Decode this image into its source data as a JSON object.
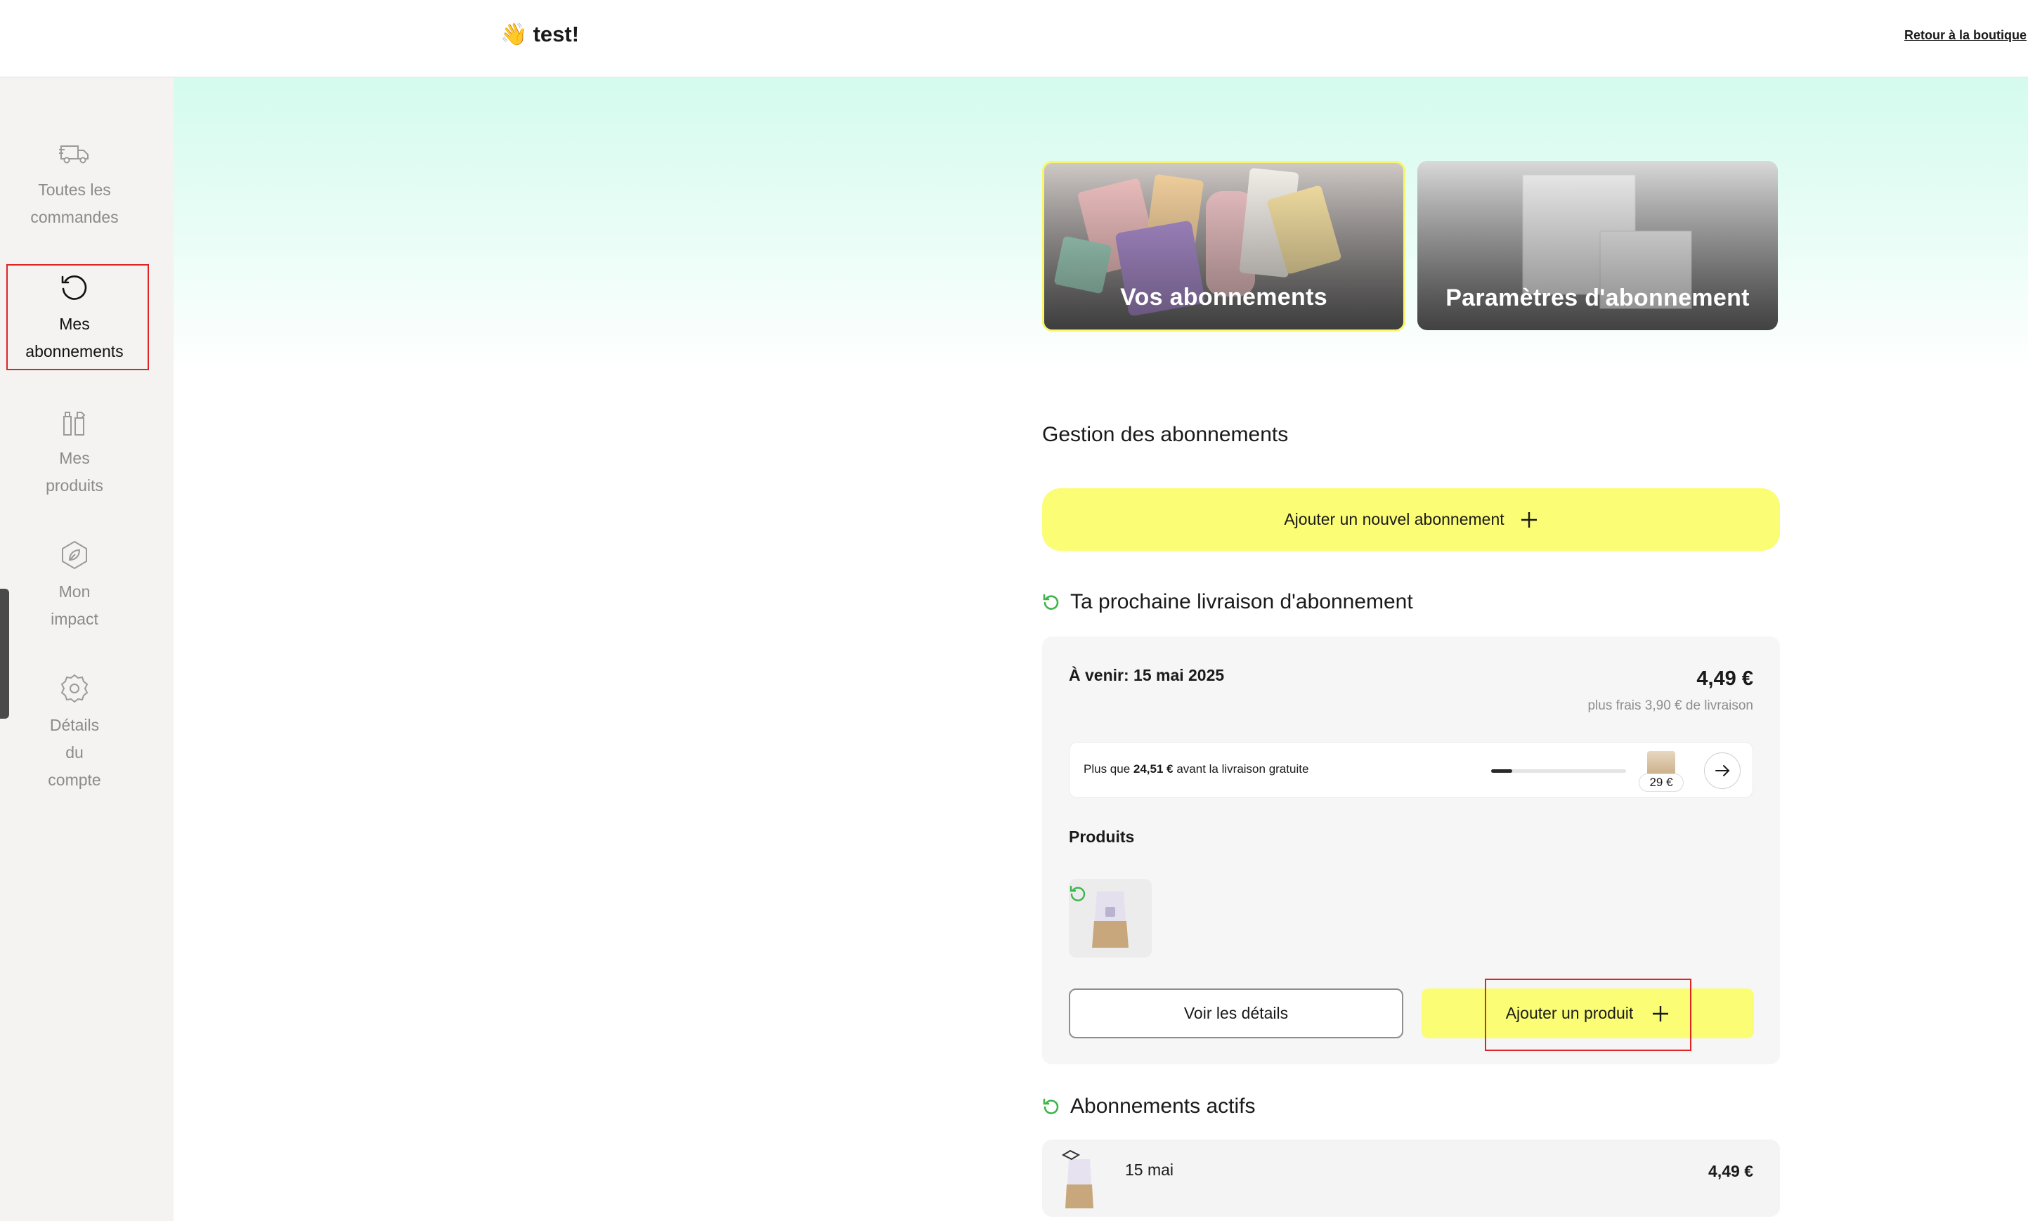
{
  "header": {
    "wave_emoji": "👋",
    "greeting": "test!",
    "back_link": "Retour à la boutique"
  },
  "sidebar": {
    "items": [
      {
        "label_line1": "Toutes les",
        "label_line2": "commandes",
        "icon": "truck-icon"
      },
      {
        "label_line1": "Mes",
        "label_line2": "abonnements",
        "icon": "refresh-icon"
      },
      {
        "label_line1": "Mes",
        "label_line2": "produits",
        "icon": "bottles-icon"
      },
      {
        "label_line1": "Mon",
        "label_line2": "impact",
        "icon": "leaf-icon"
      },
      {
        "label_line1": "Détails",
        "label_line2": "du",
        "label_line3": "compte",
        "icon": "gear-icon"
      }
    ],
    "active_index": 1
  },
  "cards": {
    "subscriptions": "Vos abonnements",
    "settings": "Paramètres d'abonnement"
  },
  "management": {
    "title": "Gestion des abonnements",
    "add_new": "Ajouter un nouvel abonnement"
  },
  "next_delivery": {
    "title": "Ta prochaine livraison d'abonnement",
    "upcoming": "À venir: 15 mai 2025",
    "price": "4,49 €",
    "shipping_note": "plus frais 3,90 € de livraison",
    "free_shipping_prefix": "Plus que ",
    "free_shipping_amount": "24,51 €",
    "free_shipping_suffix": " avant la livraison gratuite",
    "progress_fraction": 0.155,
    "goal_label": "29 €",
    "products_label": "Produits",
    "details_button": "Voir les détails",
    "add_product_button": "Ajouter un produit"
  },
  "active": {
    "title": "Abonnements actifs",
    "rows": [
      {
        "date": "15 mai",
        "price": "4,49 €"
      }
    ]
  },
  "colors": {
    "accent_yellow": "#fbfd74",
    "accent_green": "#3bb54a",
    "highlight_red": "#e02424"
  }
}
